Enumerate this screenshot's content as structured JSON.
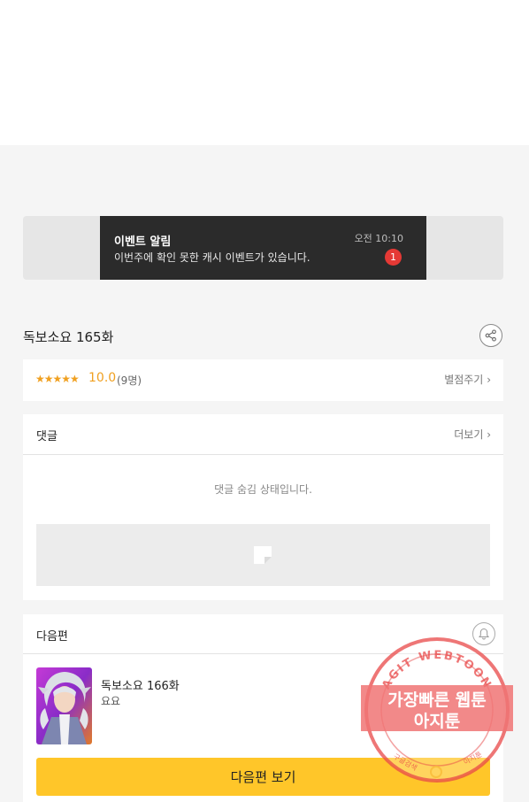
{
  "notification": {
    "title": "이벤트 알림",
    "body": "이번주에 확인 못한 캐시 이벤트가 있습니다.",
    "time": "오전 10:10",
    "badge_count": "1"
  },
  "episode": {
    "title": "독보소요 165화",
    "share_icon": "share-icon"
  },
  "rating": {
    "stars": "★★★★★",
    "score": "10.0",
    "count": "(9명)",
    "rate_link": "별점주기",
    "chevron": "›",
    "star_color": "#f0a020"
  },
  "comments": {
    "header": "댓글",
    "more_link": "더보기",
    "chevron": "›",
    "hidden_message": "댓글 숨김 상태입니다."
  },
  "next_episode": {
    "header": "다음편",
    "title": "독보소요 166화",
    "subtitle": "요요",
    "button_label": "다음편 보기",
    "bell_icon": "bell-icon",
    "button_color": "#ffc629"
  },
  "watermark": {
    "line1": "가장빠른 웹툰",
    "line2": "아지툰",
    "arc_text": "AGIT WEBTOON",
    "bottom_left": "구글검색",
    "bottom_right": "아지툰"
  }
}
